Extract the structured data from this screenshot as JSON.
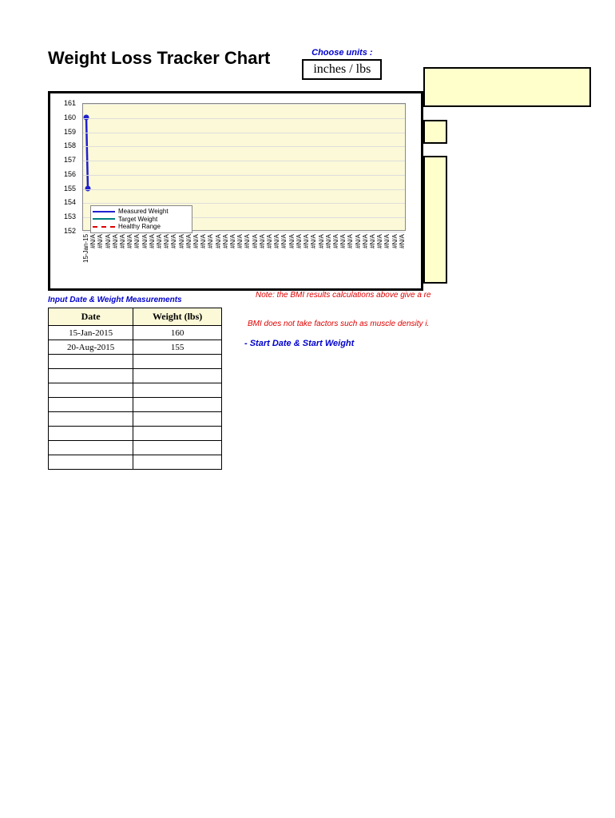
{
  "title": "Weight Loss Tracker Chart",
  "units": {
    "label": "Choose units :",
    "value": "inches / lbs"
  },
  "chart_data": {
    "type": "line",
    "ylabel": "",
    "xlabel": "",
    "ylim": [
      152,
      161
    ],
    "yticks": [
      152,
      153,
      154,
      155,
      156,
      157,
      158,
      159,
      160,
      161
    ],
    "categories": [
      "15-Jan-15",
      "#N/A",
      "#N/A",
      "#N/A",
      "#N/A",
      "#N/A",
      "#N/A",
      "#N/A",
      "#N/A",
      "#N/A",
      "#N/A",
      "#N/A",
      "#N/A",
      "#N/A",
      "#N/A",
      "#N/A",
      "#N/A",
      "#N/A",
      "#N/A",
      "#N/A",
      "#N/A",
      "#N/A",
      "#N/A",
      "#N/A",
      "#N/A",
      "#N/A",
      "#N/A",
      "#N/A",
      "#N/A",
      "#N/A",
      "#N/A",
      "#N/A",
      "#N/A",
      "#N/A",
      "#N/A",
      "#N/A",
      "#N/A",
      "#N/A",
      "#N/A",
      "#N/A",
      "#N/A",
      "#N/A",
      "#N/A",
      "#N/A"
    ],
    "series": [
      {
        "name": "Measured Weight",
        "color": "#2020d0",
        "style": "solid",
        "values": [
          160,
          155
        ]
      },
      {
        "name": "Target Weight",
        "color": "#008080",
        "style": "solid",
        "values": []
      },
      {
        "name": "Healthy Range",
        "color": "#e00000",
        "style": "dashed",
        "values": []
      }
    ]
  },
  "instruction": "Input Date & Weight Measurements",
  "notes": {
    "n1": "Note: the BMI results calculations above give a re",
    "n2": "BMI does not take factors such as muscle density i."
  },
  "start_hint": "- Start Date & Start Weight",
  "table": {
    "headers": {
      "date": "Date",
      "weight": "Weight (lbs)"
    },
    "rows": [
      {
        "date": "15-Jan-2015",
        "weight": "160"
      },
      {
        "date": "20-Aug-2015",
        "weight": "155"
      },
      {
        "date": "",
        "weight": ""
      },
      {
        "date": "",
        "weight": ""
      },
      {
        "date": "",
        "weight": ""
      },
      {
        "date": "",
        "weight": ""
      },
      {
        "date": "",
        "weight": ""
      },
      {
        "date": "",
        "weight": ""
      },
      {
        "date": "",
        "weight": ""
      },
      {
        "date": "",
        "weight": ""
      }
    ]
  }
}
